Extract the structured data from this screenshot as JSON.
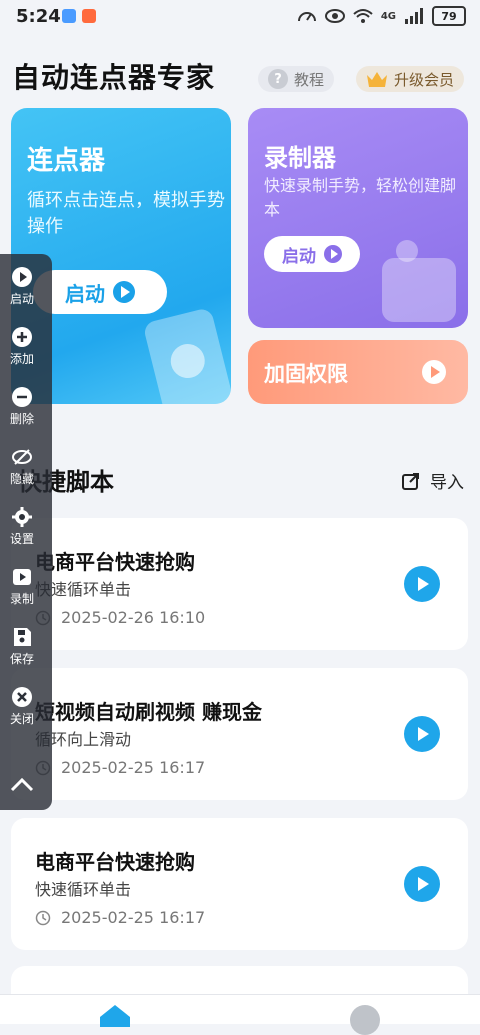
{
  "status_bar": {
    "time": "5:24",
    "network": "4G",
    "battery": "79"
  },
  "header": {
    "title": "自动连点器专家",
    "tutorial_label": "教程",
    "vip_label": "升级会员"
  },
  "cards": {
    "clicker": {
      "title": "连点器",
      "description": "循环点击连点，模拟手势操作",
      "button": "启动"
    },
    "recorder": {
      "title": "录制器",
      "description": "快速录制手势，轻松创建脚本",
      "button": "启动"
    },
    "permission": {
      "title": "加固权限"
    }
  },
  "section": {
    "title": "快捷脚本",
    "import_label": "导入"
  },
  "scripts": [
    {
      "name": "电商平台快速抢购",
      "desc": "快速循环单击",
      "date": "2025-02-26 16:10"
    },
    {
      "name": "短视频自动刷视频 赚现金",
      "desc": "循环向上滑动",
      "date": "2025-02-25 16:17"
    },
    {
      "name": "电商平台快速抢购",
      "desc": "快速循环单击",
      "date": "2025-02-25 16:17"
    }
  ],
  "toolbar": {
    "items": [
      {
        "label": "启动",
        "icon": "play-icon"
      },
      {
        "label": "添加",
        "icon": "plus-icon"
      },
      {
        "label": "删除",
        "icon": "minus-icon"
      },
      {
        "label": "隐藏",
        "icon": "eye-off-icon"
      },
      {
        "label": "设置",
        "icon": "gear-icon"
      },
      {
        "label": "录制",
        "icon": "record-icon"
      },
      {
        "label": "保存",
        "icon": "save-icon"
      },
      {
        "label": "关闭",
        "icon": "close-icon"
      }
    ]
  },
  "colors": {
    "clicker_card": "#22a8ee",
    "recorder_card": "#8a6fe9",
    "permission_card": "#ff9a7a",
    "run_button": "#1fa6ea"
  }
}
